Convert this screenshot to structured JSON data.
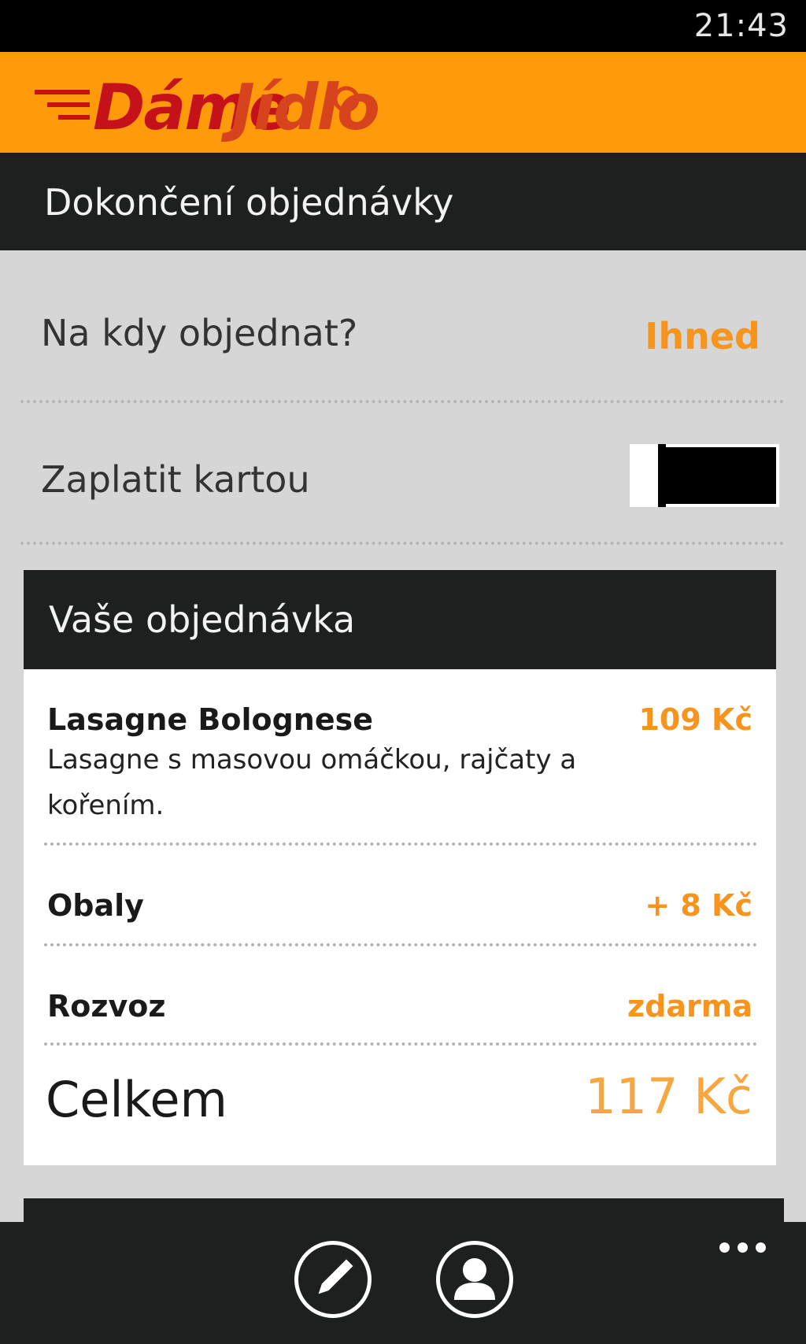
{
  "status_bar": {
    "time": "21:43"
  },
  "brand": {
    "logo_word_1": "Dáme",
    "logo_word_2": "Jídlo",
    "accent_color": "#ff9b0a"
  },
  "page": {
    "title": "Dokončení objednávky"
  },
  "options": {
    "order_time": {
      "label": "Na kdy objednat?",
      "value": "Ihned"
    },
    "pay_by_card": {
      "label": "Zaplatit kartou",
      "enabled": false
    }
  },
  "order": {
    "title": "Vaše objednávka",
    "item": {
      "name": "Lasagne Bolognese",
      "price": "109 Kč",
      "description": "Lasagne s masovou omáčkou, rajčaty a kořením."
    },
    "packaging": {
      "label": "Obaly",
      "price": "+ 8 Kč"
    },
    "delivery": {
      "label": "Rozvoz",
      "price": "zdarma"
    },
    "total": {
      "label": "Celkem",
      "value": "117 Kč"
    }
  },
  "app_bar": {
    "buttons": [
      {
        "icon": "pencil-icon"
      },
      {
        "icon": "user-icon"
      }
    ],
    "more": "more-icon"
  }
}
